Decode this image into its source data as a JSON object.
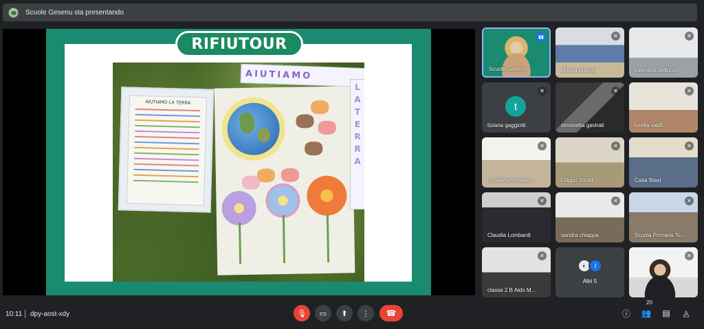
{
  "topbar": {
    "presenting_text": "Scuole Gesenu sta presentando"
  },
  "slide": {
    "logo_text": "RIFIUTOUR",
    "banner_text": "AIUTIAMO",
    "banner_vertical": [
      "L",
      "A",
      "T",
      "E",
      "R",
      "R",
      "A"
    ],
    "poster_title": "AIUTIAMO LA TERRA"
  },
  "participants": [
    {
      "name": "Scuole Gesenu",
      "muted": false,
      "speaking": true
    },
    {
      "name": "Milena Mariotti",
      "muted": true
    },
    {
      "name": "valentina bellucci",
      "muted": true
    },
    {
      "name": "tiziana gaggiotti",
      "muted": true,
      "initial": "t"
    },
    {
      "name": "simonetta gavirati",
      "muted": true
    },
    {
      "name": "lorella saldi",
      "muted": true
    },
    {
      "name": "donatella tomasso...",
      "muted": true
    },
    {
      "name": "Filippo Stirati",
      "muted": true
    },
    {
      "name": "Catia Biasi",
      "muted": true
    },
    {
      "name": "Claudia Lombardi",
      "muted": true
    },
    {
      "name": "sandra chiappa",
      "muted": true
    },
    {
      "name": "Scuola Primaria To...",
      "muted": true
    },
    {
      "name": "classe 2 B Aldo M...",
      "muted": true
    },
    {
      "name": "Altri 5",
      "others_initial": "I"
    },
    {
      "name": "",
      "muted": true
    }
  ],
  "bottombar": {
    "time": "10:11",
    "meeting_code": "dpy-aost-xdy",
    "participant_count": "20"
  },
  "colors": {
    "accent_red": "#ea4335",
    "accent_blue": "#1a73e8",
    "slide_green": "#1a8a70"
  }
}
